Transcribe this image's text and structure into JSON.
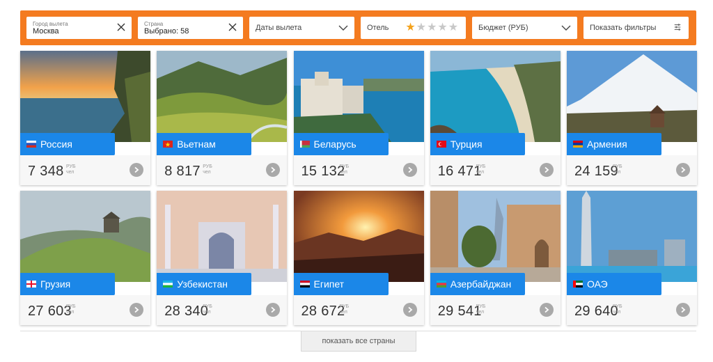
{
  "filters": {
    "city": {
      "label": "Город вылета",
      "value": "Москва"
    },
    "country": {
      "label": "Страна",
      "value": "Выбрано: 58"
    },
    "dates": {
      "placeholder": "Даты вылета"
    },
    "hotel": {
      "label": "Отель",
      "stars_selected": 1,
      "stars_total": 5
    },
    "budget": {
      "placeholder": "Бюджет (РУБ)"
    },
    "more": {
      "label": "Показать фильтры"
    }
  },
  "price_unit": {
    "currency": "РУБ",
    "per": "чел"
  },
  "destinations": [
    {
      "name": "Россия",
      "price": "7 348",
      "flag": "russia-flag"
    },
    {
      "name": "Вьетнам",
      "price": "8 817",
      "flag": "vietnam-flag"
    },
    {
      "name": "Беларусь",
      "price": "15 132",
      "flag": "belarus-flag"
    },
    {
      "name": "Турция",
      "price": "16 471",
      "flag": "turkey-flag"
    },
    {
      "name": "Армения",
      "price": "24 159",
      "flag": "armenia-flag"
    },
    {
      "name": "Грузия",
      "price": "27 603",
      "flag": "georgia-flag"
    },
    {
      "name": "Узбекистан",
      "price": "28 340",
      "flag": "uzbekistan-flag"
    },
    {
      "name": "Египет",
      "price": "28 672",
      "flag": "egypt-flag"
    },
    {
      "name": "Азербайджан",
      "price": "29 541",
      "flag": "azerbaijan-flag"
    },
    {
      "name": "ОАЭ",
      "price": "29 640",
      "flag": "uae-flag"
    }
  ],
  "show_all_label": "показать все страны",
  "colors": {
    "accent": "#f47b20",
    "label_blue": "#1b87e8",
    "star": "#f4a21d"
  }
}
